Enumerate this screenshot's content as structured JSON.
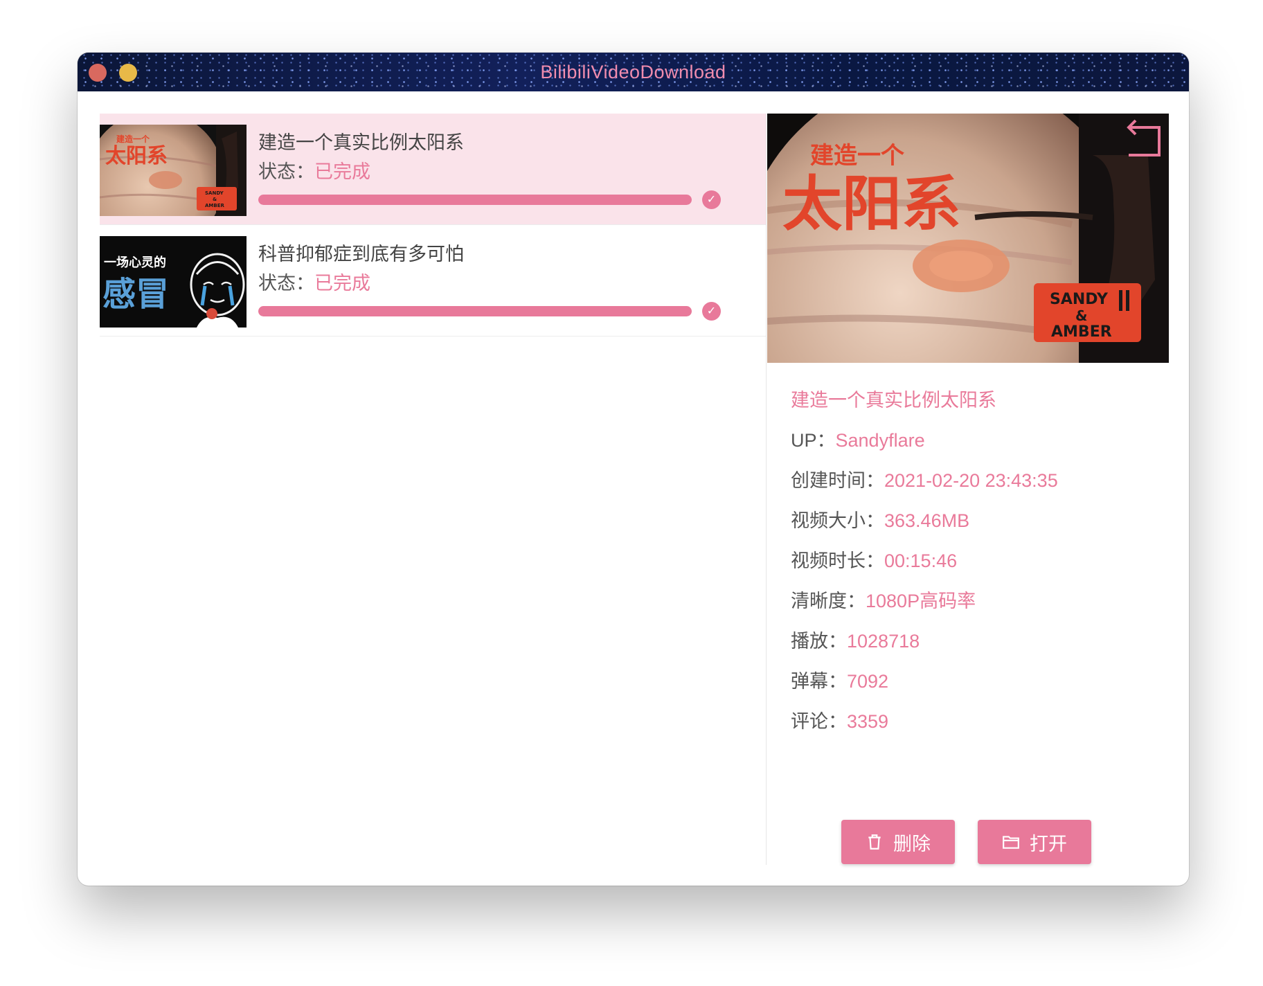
{
  "window": {
    "title": "BilibiliVideoDownload"
  },
  "list": {
    "items": [
      {
        "title": "建造一个真实比例太阳系",
        "status_label": "状态：",
        "status_value": "已完成",
        "progress": 1.0,
        "thumb_text_small": "建造一个",
        "thumb_text_big": "太阳系",
        "thumb_badge": [
          "SANDY",
          "&",
          "AMBER"
        ],
        "selected": true
      },
      {
        "title": "科普抑郁症到底有多可怕",
        "status_label": "状态：",
        "status_value": "已完成",
        "progress": 1.0,
        "thumb_text_small": "一场心灵的",
        "thumb_text_big": "感冒",
        "selected": false
      }
    ]
  },
  "detail": {
    "cover_text_small": "建造一个",
    "cover_text_big": "太阳系",
    "cover_badge": [
      "SANDY",
      "&",
      "AMBER"
    ],
    "title": "建造一个真实比例太阳系",
    "fields": [
      {
        "label": "UP：",
        "value": "Sandyflare"
      },
      {
        "label": "创建时间：",
        "value": "2021-02-20 23:43:35"
      },
      {
        "label": "视频大小：",
        "value": "363.46MB"
      },
      {
        "label": "视频时长：",
        "value": "00:15:46"
      },
      {
        "label": "清晰度：",
        "value": "1080P高码率"
      },
      {
        "label": "播放：",
        "value": "1028718"
      },
      {
        "label": "弹幕：",
        "value": "7092"
      },
      {
        "label": "评论：",
        "value": "3359"
      }
    ],
    "delete_label": "删除",
    "open_label": "打开"
  },
  "colors": {
    "accent": "#e8799a",
    "accent_text": "#e97a9a",
    "selected_row": "#fae3ea",
    "titlebar": "#0a1640"
  },
  "icons": [
    "check-icon",
    "back-icon",
    "trash-icon",
    "folder-icon"
  ]
}
